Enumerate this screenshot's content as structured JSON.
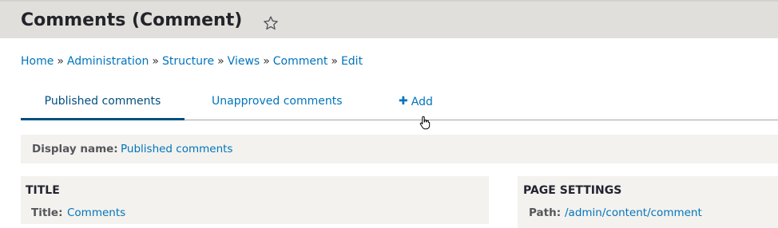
{
  "header": {
    "title": "Comments (Comment)",
    "favorite_icon": "star-outline-icon"
  },
  "breadcrumb": [
    "Home",
    "Administration",
    "Structure",
    "Views",
    "Comment",
    "Edit"
  ],
  "breadcrumb_separator": "»",
  "tabs": [
    {
      "label": "Published comments",
      "active": true
    },
    {
      "label": "Unapproved comments",
      "active": false
    },
    {
      "label": "Add",
      "icon": "plus-icon"
    }
  ],
  "display": {
    "label": "Display name:",
    "value": "Published comments"
  },
  "title_section": {
    "heading": "TITLE",
    "label": "Title:",
    "value": "Comments"
  },
  "page_settings": {
    "heading": "PAGE SETTINGS",
    "label": "Path:",
    "value": "/admin/content/comment"
  },
  "colors": {
    "link": "#0074bd",
    "active_tab": "#004f80",
    "header_bg": "#e0dfdc",
    "panel_bg": "#f3f2ee"
  }
}
